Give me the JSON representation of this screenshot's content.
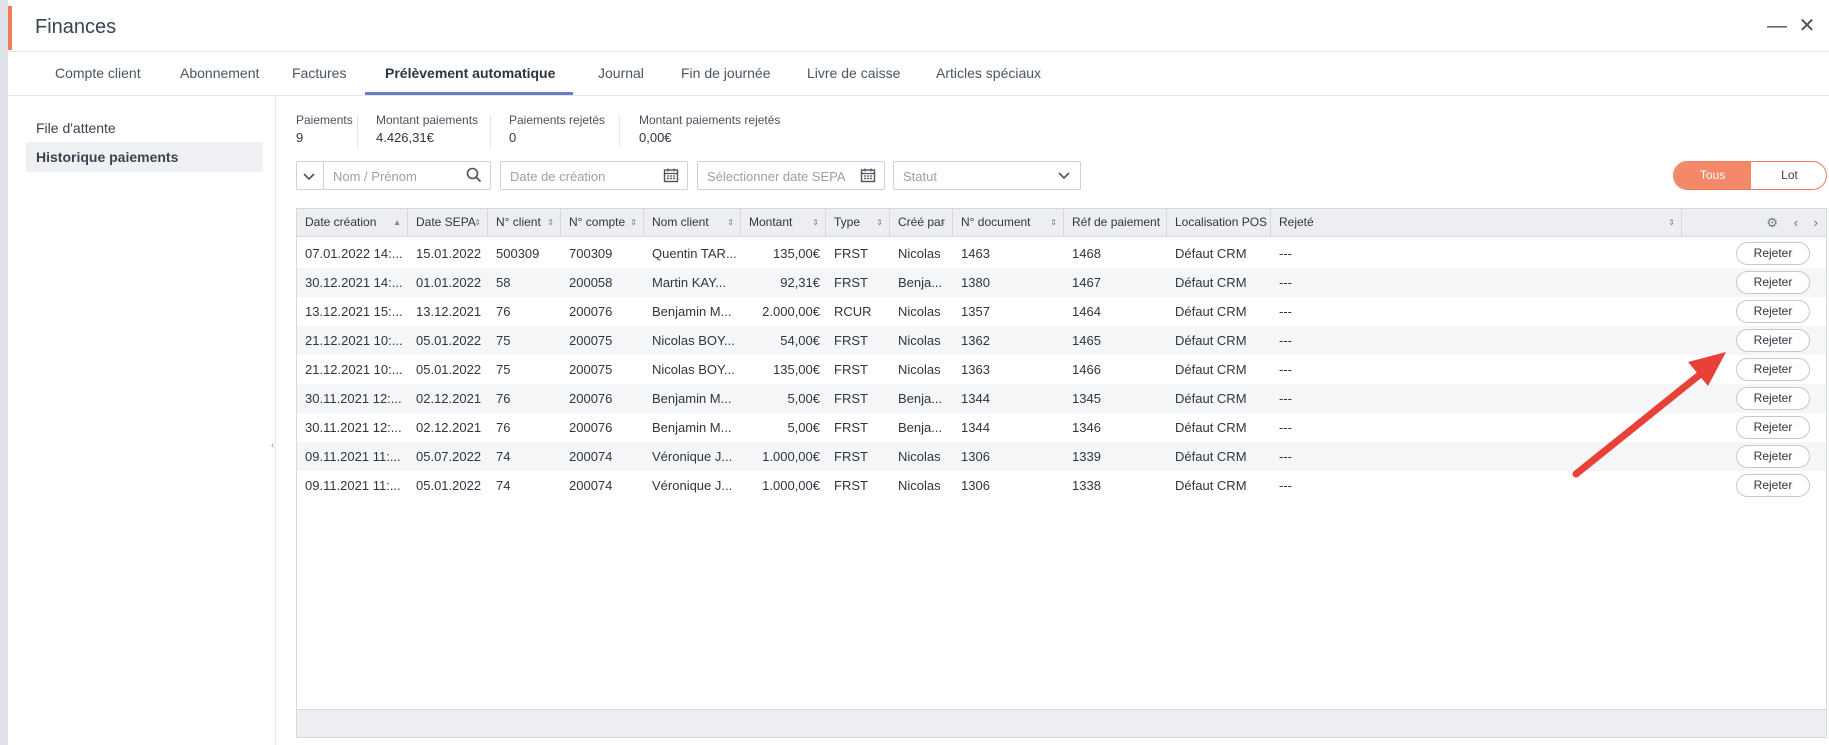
{
  "window": {
    "title": "Finances",
    "minimize_label": "—",
    "close_label": "✕"
  },
  "tabs": [
    {
      "label": "Compte client"
    },
    {
      "label": "Abonnement"
    },
    {
      "label": "Factures"
    },
    {
      "label": "Prélèvement automatique",
      "active": true
    },
    {
      "label": "Journal"
    },
    {
      "label": "Fin de journée"
    },
    {
      "label": "Livre de caisse"
    },
    {
      "label": "Articles spéciaux"
    }
  ],
  "sidebar": {
    "items": [
      {
        "label": "File d'attente"
      },
      {
        "label": "Historique paiements",
        "active": true
      }
    ]
  },
  "summary": [
    {
      "label": "Paiements",
      "value": "9"
    },
    {
      "label": "Montant paiements",
      "value": "4.426,31€"
    },
    {
      "label": "Paiements rejetés",
      "value": "0"
    },
    {
      "label": "Montant paiements rejetés",
      "value": "0,00€"
    }
  ],
  "filters": {
    "name_placeholder": "Nom / Prénom",
    "creation_date_placeholder": "Date de création",
    "sepa_date_placeholder": "Sélectionner date SEPA",
    "status_placeholder": "Statut"
  },
  "toggle": {
    "all_label": "Tous",
    "batch_label": "Lot",
    "selected": "Tous"
  },
  "table": {
    "columns": [
      "Date création",
      "Date SEPA",
      "N° client",
      "N° compte",
      "Nom client",
      "Montant",
      "Type",
      "Créé par",
      "N° document",
      "Réf de paiement",
      "Localisation POS",
      "Rejeté"
    ],
    "action_label": "Rejeter",
    "rows": [
      [
        "07.01.2022 14:...",
        "15.01.2022",
        "500309",
        "700309",
        "Quentin TAR...",
        "135,00€",
        "FRST",
        "Nicolas",
        "1463",
        "1468",
        "Défaut CRM",
        "---"
      ],
      [
        "30.12.2021 14:...",
        "01.01.2022",
        "58",
        "200058",
        "Martin KAY...",
        "92,31€",
        "FRST",
        "Benja...",
        "1380",
        "1467",
        "Défaut CRM",
        "---"
      ],
      [
        "13.12.2021 15:...",
        "13.12.2021",
        "76",
        "200076",
        "Benjamin M...",
        "2.000,00€",
        "RCUR",
        "Nicolas",
        "1357",
        "1464",
        "Défaut CRM",
        "---"
      ],
      [
        "21.12.2021 10:...",
        "05.01.2022",
        "75",
        "200075",
        "Nicolas BOY...",
        "54,00€",
        "FRST",
        "Nicolas",
        "1362",
        "1465",
        "Défaut CRM",
        "---"
      ],
      [
        "21.12.2021 10:...",
        "05.01.2022",
        "75",
        "200075",
        "Nicolas BOY...",
        "135,00€",
        "FRST",
        "Nicolas",
        "1363",
        "1466",
        "Défaut CRM",
        "---"
      ],
      [
        "30.11.2021 12:...",
        "02.12.2021",
        "76",
        "200076",
        "Benjamin M...",
        "5,00€",
        "FRST",
        "Benja...",
        "1344",
        "1345",
        "Défaut CRM",
        "---"
      ],
      [
        "30.11.2021 12:...",
        "02.12.2021",
        "76",
        "200076",
        "Benjamin M...",
        "5,00€",
        "FRST",
        "Benja...",
        "1344",
        "1346",
        "Défaut CRM",
        "---"
      ],
      [
        "09.11.2021 11:...",
        "05.07.2022",
        "74",
        "200074",
        "Véronique J...",
        "1.000,00€",
        "FRST",
        "Nicolas",
        "1306",
        "1339",
        "Défaut CRM",
        "---"
      ],
      [
        "09.11.2021 11:...",
        "05.01.2022",
        "74",
        "200074",
        "Véronique J...",
        "1.000,00€",
        "FRST",
        "Nicolas",
        "1306",
        "1338",
        "Défaut CRM",
        "---"
      ]
    ]
  },
  "colors": {
    "accent": "#f07c5f",
    "tab_underline": "#6a7ec8",
    "annotation_arrow": "#e8413a"
  },
  "icons": [
    "search-icon",
    "calendar-icon",
    "chevron-down-icon",
    "gear-icon",
    "chevron-left-icon",
    "chevron-right-icon",
    "sort-icon"
  ]
}
